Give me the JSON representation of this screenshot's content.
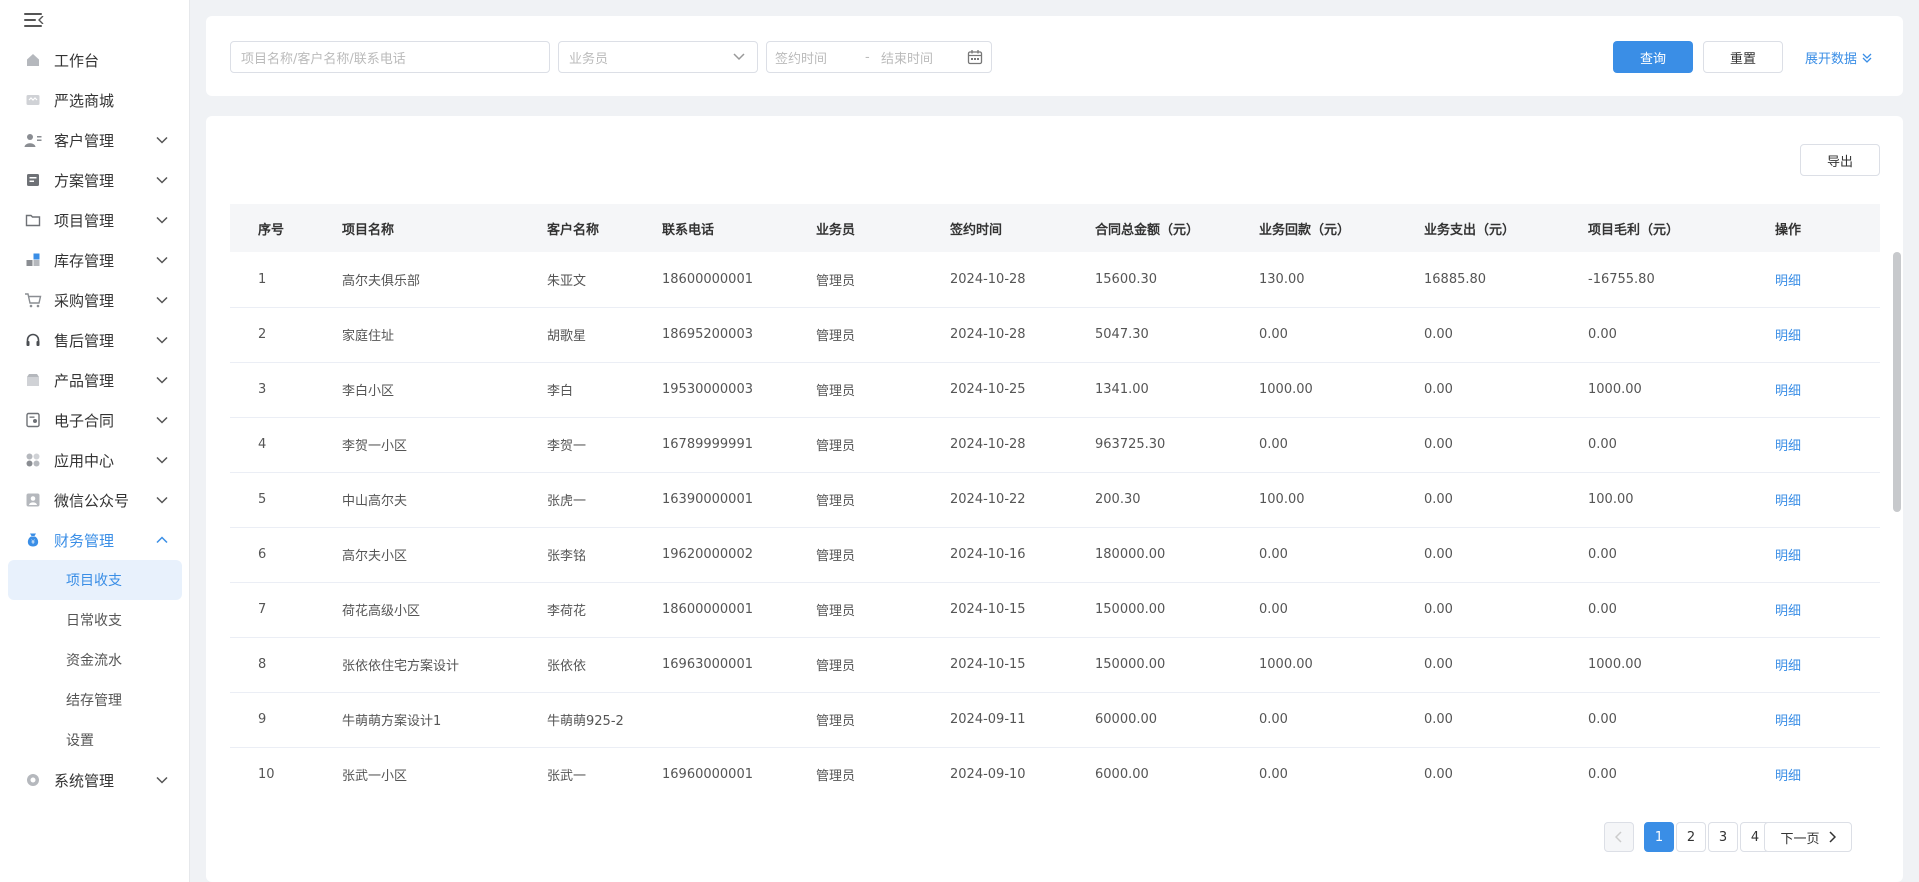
{
  "sidebar": {
    "items": [
      {
        "label": "工作台",
        "icon": "home-icon",
        "has_children": false
      },
      {
        "label": "严选商城",
        "icon": "store-icon",
        "has_children": false
      },
      {
        "label": "客户管理",
        "icon": "customer-icon",
        "has_children": true
      },
      {
        "label": "方案管理",
        "icon": "plan-icon",
        "has_children": true
      },
      {
        "label": "项目管理",
        "icon": "folder-icon",
        "has_children": true
      },
      {
        "label": "库存管理",
        "icon": "inventory-icon",
        "has_children": true
      },
      {
        "label": "采购管理",
        "icon": "cart-icon",
        "has_children": true
      },
      {
        "label": "售后管理",
        "icon": "headset-icon",
        "has_children": true
      },
      {
        "label": "产品管理",
        "icon": "product-icon",
        "has_children": true
      },
      {
        "label": "电子合同",
        "icon": "contract-icon",
        "has_children": true
      },
      {
        "label": "应用中心",
        "icon": "apps-icon",
        "has_children": true
      },
      {
        "label": "微信公众号",
        "icon": "wechat-icon",
        "has_children": true
      }
    ],
    "finance": {
      "label": "财务管理",
      "icon": "money-bag-icon",
      "children": [
        "项目收支",
        "日常收支",
        "资金流水",
        "结存管理",
        "设置"
      ],
      "active_child": "项目收支"
    },
    "system": {
      "label": "系统管理",
      "icon": "system-icon"
    }
  },
  "filters": {
    "search_placeholder": "项目名称/客户名称/联系电话",
    "salesperson_placeholder": "业务员",
    "sign_start_placeholder": "签约时间",
    "date_separator": "-",
    "sign_end_placeholder": "结束时间",
    "query_label": "查询",
    "reset_label": "重置",
    "expand_label": "展开数据"
  },
  "table": {
    "export_label": "导出",
    "columns": [
      "序号",
      "项目名称",
      "客户名称",
      "联系电话",
      "业务员",
      "签约时间",
      "合同总金额（元）",
      "业务回款（元）",
      "业务支出（元）",
      "项目毛利（元）",
      "操作"
    ],
    "rows": [
      {
        "no": "1",
        "project": "高尔夫俱乐部",
        "customer": "朱亚文",
        "phone": "18600000001",
        "sales": "管理员",
        "date": "2024-10-28",
        "total": "15600.30",
        "received": "130.00",
        "expense": "16885.80",
        "profit": "-16755.80",
        "op": "明细"
      },
      {
        "no": "2",
        "project": "家庭住址",
        "customer": "胡歌星",
        "phone": "18695200003",
        "sales": "管理员",
        "date": "2024-10-28",
        "total": "5047.30",
        "received": "0.00",
        "expense": "0.00",
        "profit": "0.00",
        "op": "明细"
      },
      {
        "no": "3",
        "project": "李白小区",
        "customer": "李白",
        "phone": "19530000003",
        "sales": "管理员",
        "date": "2024-10-25",
        "total": "1341.00",
        "received": "1000.00",
        "expense": "0.00",
        "profit": "1000.00",
        "op": "明细"
      },
      {
        "no": "4",
        "project": "李贺一小区",
        "customer": "李贺一",
        "phone": "16789999991",
        "sales": "管理员",
        "date": "2024-10-28",
        "total": "963725.30",
        "received": "0.00",
        "expense": "0.00",
        "profit": "0.00",
        "op": "明细"
      },
      {
        "no": "5",
        "project": "中山高尔夫",
        "customer": "张虎一",
        "phone": "16390000001",
        "sales": "管理员",
        "date": "2024-10-22",
        "total": "200.30",
        "received": "100.00",
        "expense": "0.00",
        "profit": "100.00",
        "op": "明细"
      },
      {
        "no": "6",
        "project": "高尔夫小区",
        "customer": "张李铭",
        "phone": "19620000002",
        "sales": "管理员",
        "date": "2024-10-16",
        "total": "180000.00",
        "received": "0.00",
        "expense": "0.00",
        "profit": "0.00",
        "op": "明细"
      },
      {
        "no": "7",
        "project": "荷花高级小区",
        "customer": "李荷花",
        "phone": "18600000001",
        "sales": "管理员",
        "date": "2024-10-15",
        "total": "150000.00",
        "received": "0.00",
        "expense": "0.00",
        "profit": "0.00",
        "op": "明细"
      },
      {
        "no": "8",
        "project": "张依依住宅方案设计",
        "customer": "张依依",
        "phone": "16963000001",
        "sales": "管理员",
        "date": "2024-10-15",
        "total": "150000.00",
        "received": "1000.00",
        "expense": "0.00",
        "profit": "1000.00",
        "op": "明细"
      },
      {
        "no": "9",
        "project": "牛萌萌方案设计1",
        "customer": "牛萌萌925-2",
        "phone": "",
        "sales": "管理员",
        "date": "2024-09-11",
        "total": "60000.00",
        "received": "0.00",
        "expense": "0.00",
        "profit": "0.00",
        "op": "明细"
      },
      {
        "no": "10",
        "project": "张武一小区",
        "customer": "张武一",
        "phone": "16960000001",
        "sales": "管理员",
        "date": "2024-09-10",
        "total": "6000.00",
        "received": "0.00",
        "expense": "0.00",
        "profit": "0.00",
        "op": "明细"
      }
    ]
  },
  "pagination": {
    "pages": [
      "1",
      "2",
      "3",
      "4"
    ],
    "current": "1",
    "next_label": "下一页"
  },
  "colors": {
    "accent": "#3a8ee6",
    "sidebar_bg": "#ffffff",
    "page_bg": "#f0f2f5"
  }
}
